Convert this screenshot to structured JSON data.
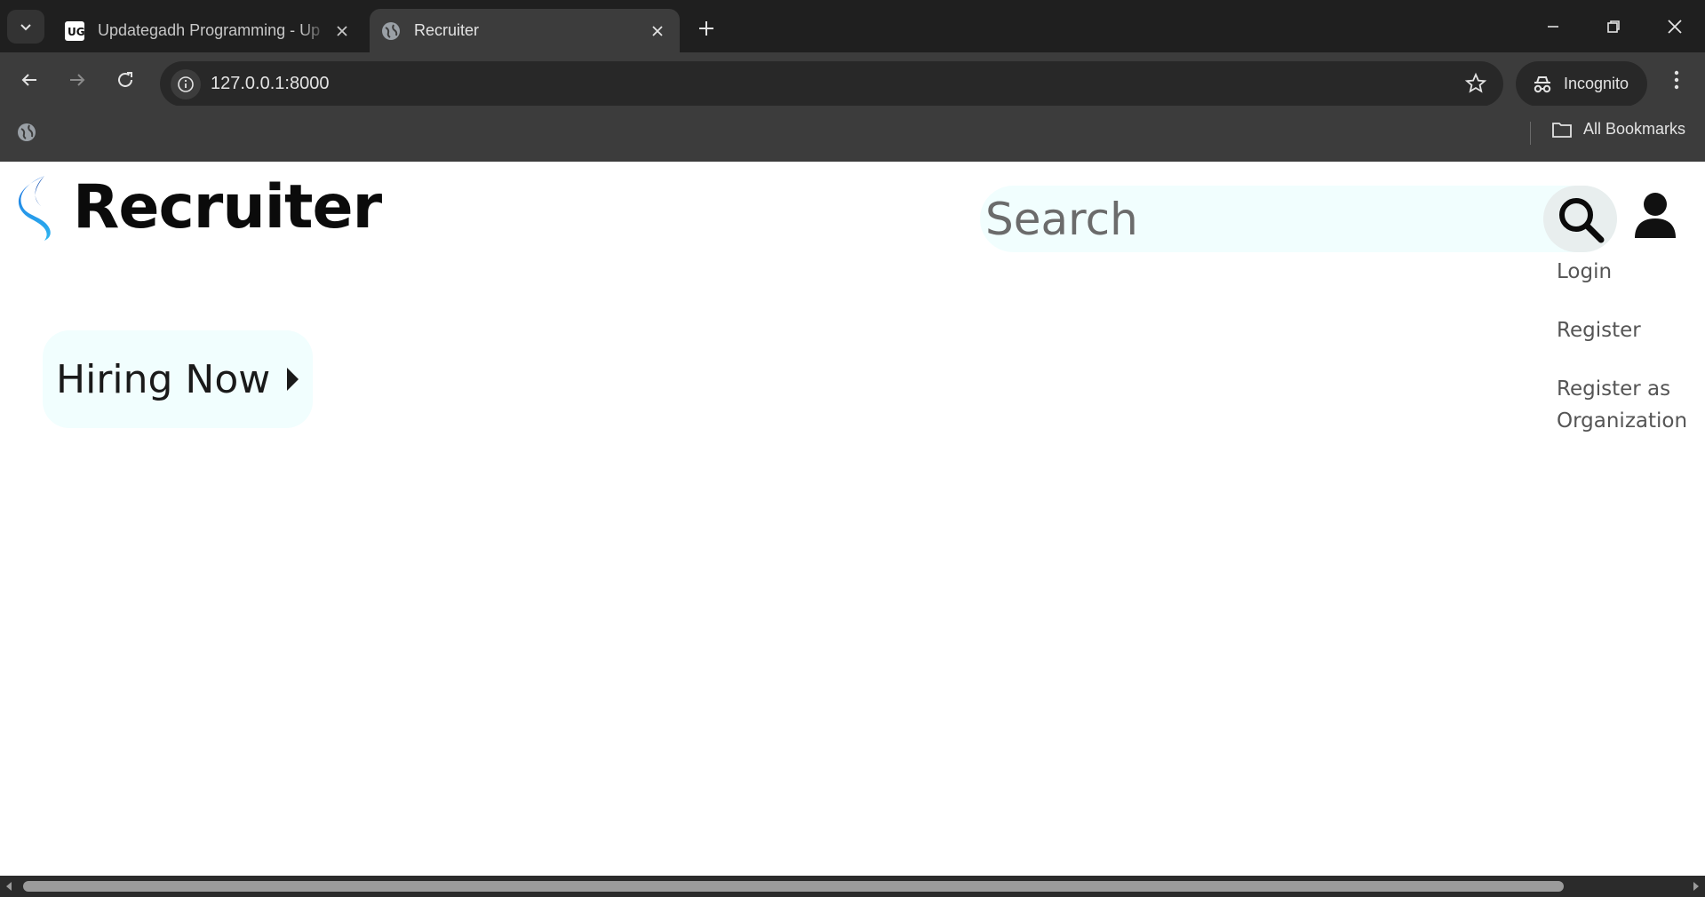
{
  "browser": {
    "tabs": [
      {
        "label": "Updategadh Programming - Up",
        "active": false,
        "favicon": "ug-logo-icon"
      },
      {
        "label": "Recruiter",
        "active": true,
        "favicon": "globe-icon"
      }
    ],
    "address": "127.0.0.1:8000",
    "incognito_label": "Incognito",
    "bookmarks_label": "All Bookmarks"
  },
  "page": {
    "brand": "Recruiter",
    "search": {
      "placeholder": "Search"
    },
    "user_menu": {
      "login": "Login",
      "register": "Register",
      "register_org": "Register as Organization"
    },
    "hiring_button": "Hiring Now"
  },
  "colors": {
    "accent_light": "#f1fefe",
    "logo_blue": "#1a6fe0",
    "logo_cyan": "#2fb6f0"
  }
}
